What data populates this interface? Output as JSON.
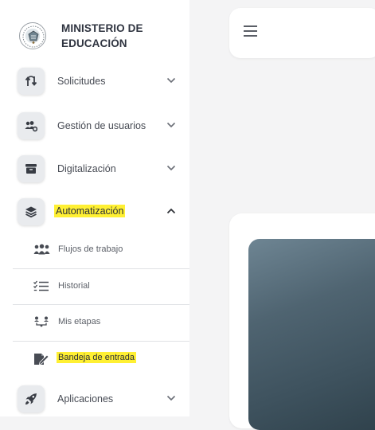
{
  "brand": {
    "title_line1": "MINISTERIO DE",
    "title_line2": "EDUCACIÓN",
    "logo_icon": "ministry-seal-icon"
  },
  "sidebar": {
    "items": [
      {
        "label": "Solicitudes",
        "icon": "exchange-arrows-icon",
        "expanded": false
      },
      {
        "label": "Gestión de usuarios",
        "icon": "users-cog-icon",
        "expanded": false
      },
      {
        "label": "Digitalización",
        "icon": "archive-box-icon",
        "expanded": false
      },
      {
        "label": "Automatización",
        "icon": "layers-icon",
        "expanded": true,
        "highlighted": true
      },
      {
        "label": "Aplicaciones",
        "icon": "rocket-icon",
        "expanded": false
      }
    ],
    "subitems": [
      {
        "label": "Flujos de trabajo",
        "icon": "people-group-icon"
      },
      {
        "label": "Historial",
        "icon": "checklist-icon"
      },
      {
        "label": "Mis etapas",
        "icon": "user-steps-icon"
      },
      {
        "label": "Bandeja de entrada",
        "icon": "file-signature-icon",
        "highlighted": true
      }
    ]
  },
  "header": {
    "menu_icon": "hamburger-menu-icon"
  },
  "colors": {
    "highlight": "#fff033",
    "sidebar_bg": "#ffffff",
    "page_bg": "#f4f4f5",
    "icon_box": "#e9ebee",
    "text": "#464a53"
  }
}
